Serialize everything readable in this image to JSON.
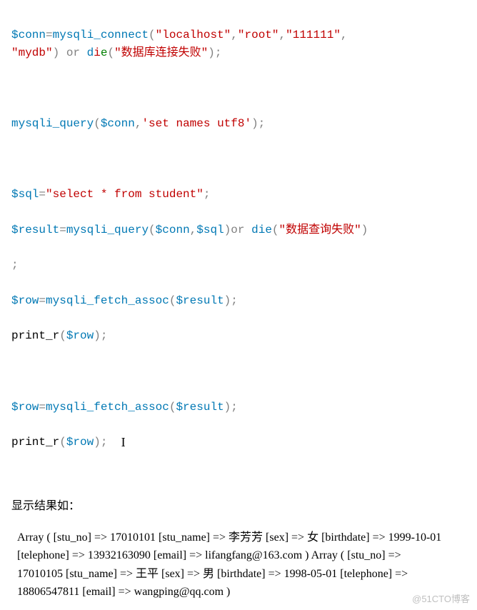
{
  "code": {
    "l1": {
      "v1": "$conn",
      "f": "mysqli_connect",
      "s1": "\"localhost\"",
      "s2": "\"root\"",
      "s3": "\"111111\"",
      "s4": "\"mydb\"",
      "kw_or": "or",
      "kw_die": "die",
      "s5": "\"数据库连接失败\""
    },
    "l2": {
      "f": "mysqli_query",
      "v1": "$conn",
      "s1": "'set names utf8'"
    },
    "l3": {
      "v1": "$sql",
      "s1": "\"select * from student\""
    },
    "l4": {
      "v1": "$result",
      "f": "mysqli_query",
      "v2": "$conn",
      "v3": "$sql",
      "kw_or": "or",
      "kw_die": "die",
      "s1": "\"数据查询失败\""
    },
    "l5": {
      "semi": ";"
    },
    "l6": {
      "v1": "$row",
      "f": "mysqli_fetch_assoc",
      "v2": "$result"
    },
    "l7": {
      "f": "print_r",
      "v1": "$row"
    },
    "l8": {
      "v1": "$row",
      "f": "mysqli_fetch_assoc",
      "v2": "$result"
    },
    "l9": {
      "f": "print_r",
      "v1": "$row"
    }
  },
  "result_intro": "显示结果如：",
  "output": "Array ( [stu_no] => 17010101 [stu_name] => 李芳芳 [sex] => 女 [birthdate] => 1999-10-01 [telephone] => 13932163090 [email] => lifangfang@163.com ) Array ( [stu_no] => 17010105 [stu_name] => 王平 [sex] => 男 [birthdate] => 1998-05-01 [telephone] => 18806547811 [email] => wangping@qq.com )",
  "watermark": "@51CTO博客"
}
